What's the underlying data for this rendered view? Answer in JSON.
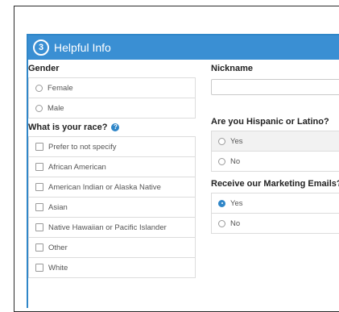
{
  "section": {
    "step": "3",
    "title": "Helpful Info"
  },
  "gender": {
    "label": "Gender",
    "options": [
      "Female",
      "Male"
    ]
  },
  "race": {
    "label": "What is your race?",
    "help_icon": "question-circle-icon",
    "options": [
      "Prefer to not specify",
      "African American",
      "American Indian or Alaska Native",
      "Asian",
      "Native Hawaiian or Pacific Islander",
      "Other",
      "White"
    ]
  },
  "nickname": {
    "label": "Nickname",
    "value": "",
    "placeholder": ""
  },
  "hispanic": {
    "label": "Are you Hispanic or Latino?",
    "options": [
      "Yes",
      "No"
    ]
  },
  "marketing": {
    "label": "Receive our Marketing Emails?",
    "options": [
      "Yes",
      "No"
    ],
    "selected": "Yes"
  },
  "colors": {
    "accent": "#3a8fd3",
    "border": "#2f86c8"
  }
}
